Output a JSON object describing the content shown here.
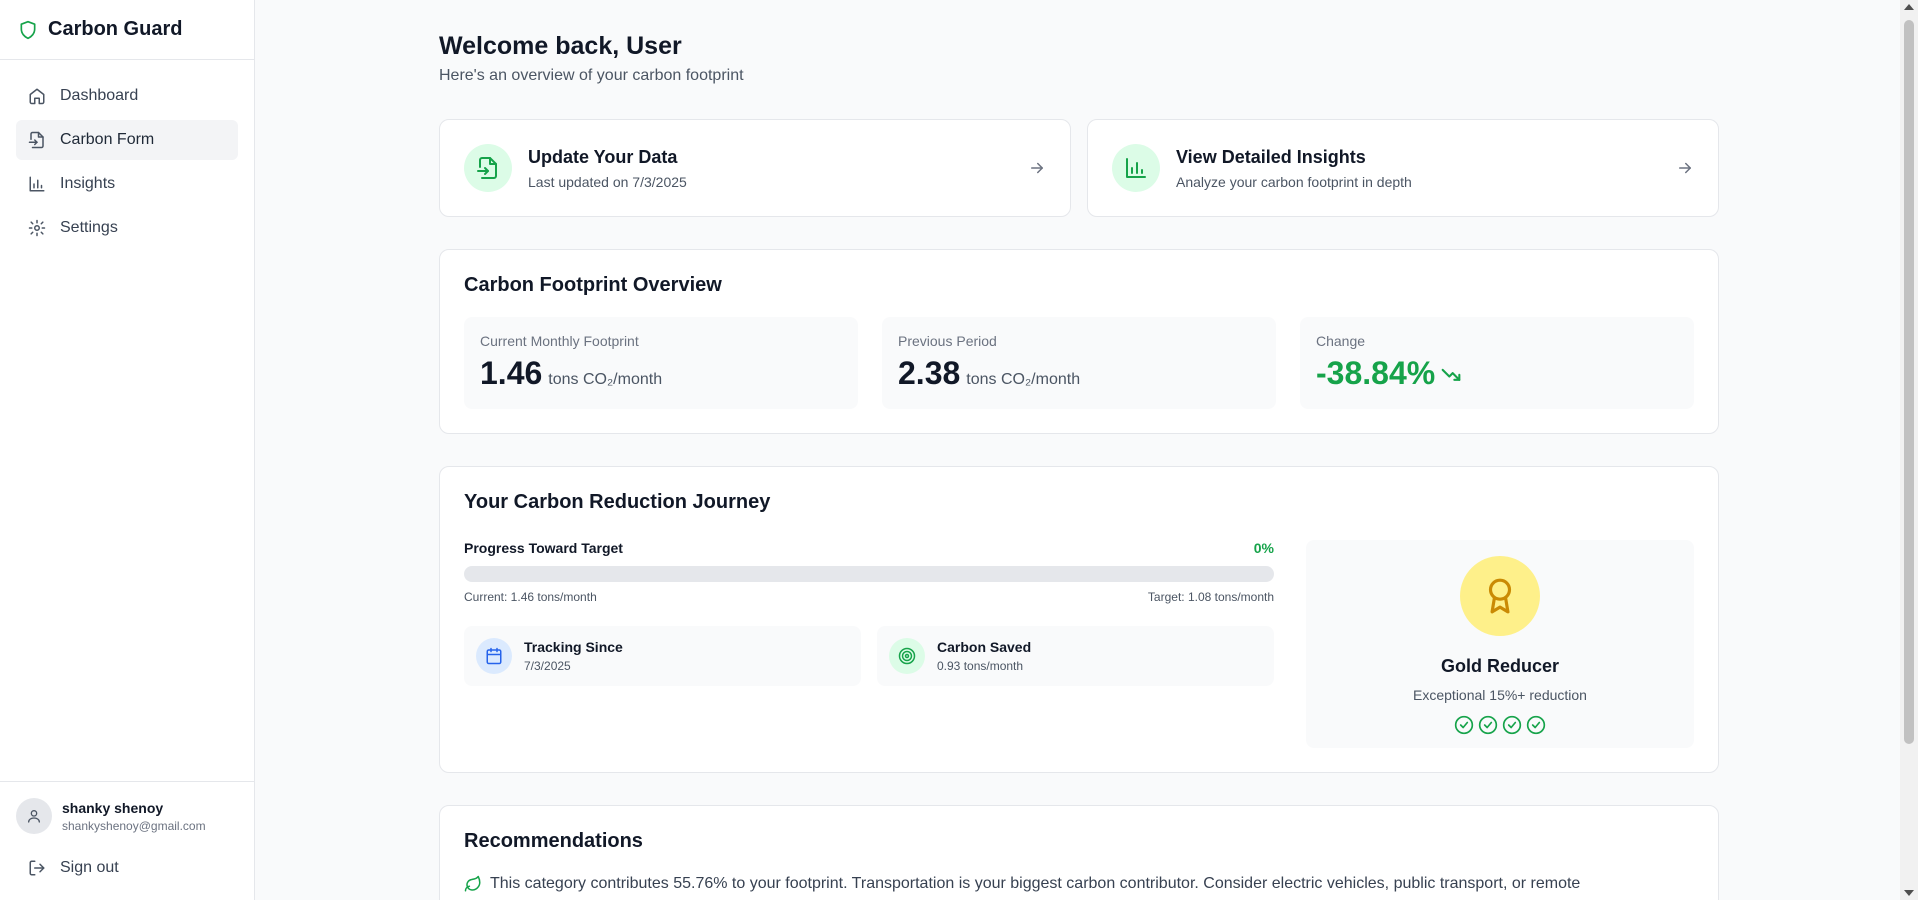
{
  "app": {
    "name": "Carbon Guard"
  },
  "sidebar": {
    "items": [
      {
        "label": "Dashboard",
        "icon": "home-icon"
      },
      {
        "label": "Carbon Form",
        "icon": "file-input-icon"
      },
      {
        "label": "Insights",
        "icon": "bar-chart-icon"
      },
      {
        "label": "Settings",
        "icon": "gear-icon"
      }
    ],
    "active_index": 1
  },
  "user": {
    "name": "shanky shenoy",
    "email": "shankyshenoy@gmail.com"
  },
  "signout_label": "Sign out",
  "header": {
    "title": "Welcome back, User",
    "subtitle": "Here's an overview of your carbon footprint"
  },
  "quick_actions": [
    {
      "title": "Update Your Data",
      "subtitle": "Last updated on 7/3/2025",
      "icon": "file-input-icon"
    },
    {
      "title": "View Detailed Insights",
      "subtitle": "Analyze your carbon footprint in depth",
      "icon": "bar-chart-icon"
    }
  ],
  "overview": {
    "title": "Carbon Footprint Overview",
    "current": {
      "label": "Current Monthly Footprint",
      "value": "1.46",
      "unit": "tons CO₂/month"
    },
    "previous": {
      "label": "Previous Period",
      "value": "2.38",
      "unit": "tons CO₂/month"
    },
    "change": {
      "label": "Change",
      "value": "-38.84%",
      "icon": "trending-down-icon"
    }
  },
  "journey": {
    "title": "Your Carbon Reduction Journey",
    "progress_label": "Progress Toward Target",
    "progress_text": "0%",
    "progress_value": 0,
    "current_text": "Current: 1.46 tons/month",
    "target_text": "Target: 1.08 tons/month",
    "tracking": {
      "title": "Tracking Since",
      "value": "7/3/2025",
      "icon": "calendar-icon"
    },
    "saved": {
      "title": "Carbon Saved",
      "value": "0.93 tons/month",
      "icon": "target-icon"
    },
    "badge": {
      "title": "Gold Reducer",
      "subtitle": "Exceptional 15%+ reduction",
      "icon": "award-icon",
      "checks": 4
    }
  },
  "recommendations": {
    "title": "Recommendations",
    "first": "This category contributes 55.76% to your footprint. Transportation is your biggest carbon contributor. Consider electric vehicles, public transport, or remote"
  },
  "colors": {
    "accent": "#16a34a",
    "icon_bg": "#dcfce7",
    "medal_bg": "#fef08a",
    "medal_icon": "#ca8a04"
  }
}
